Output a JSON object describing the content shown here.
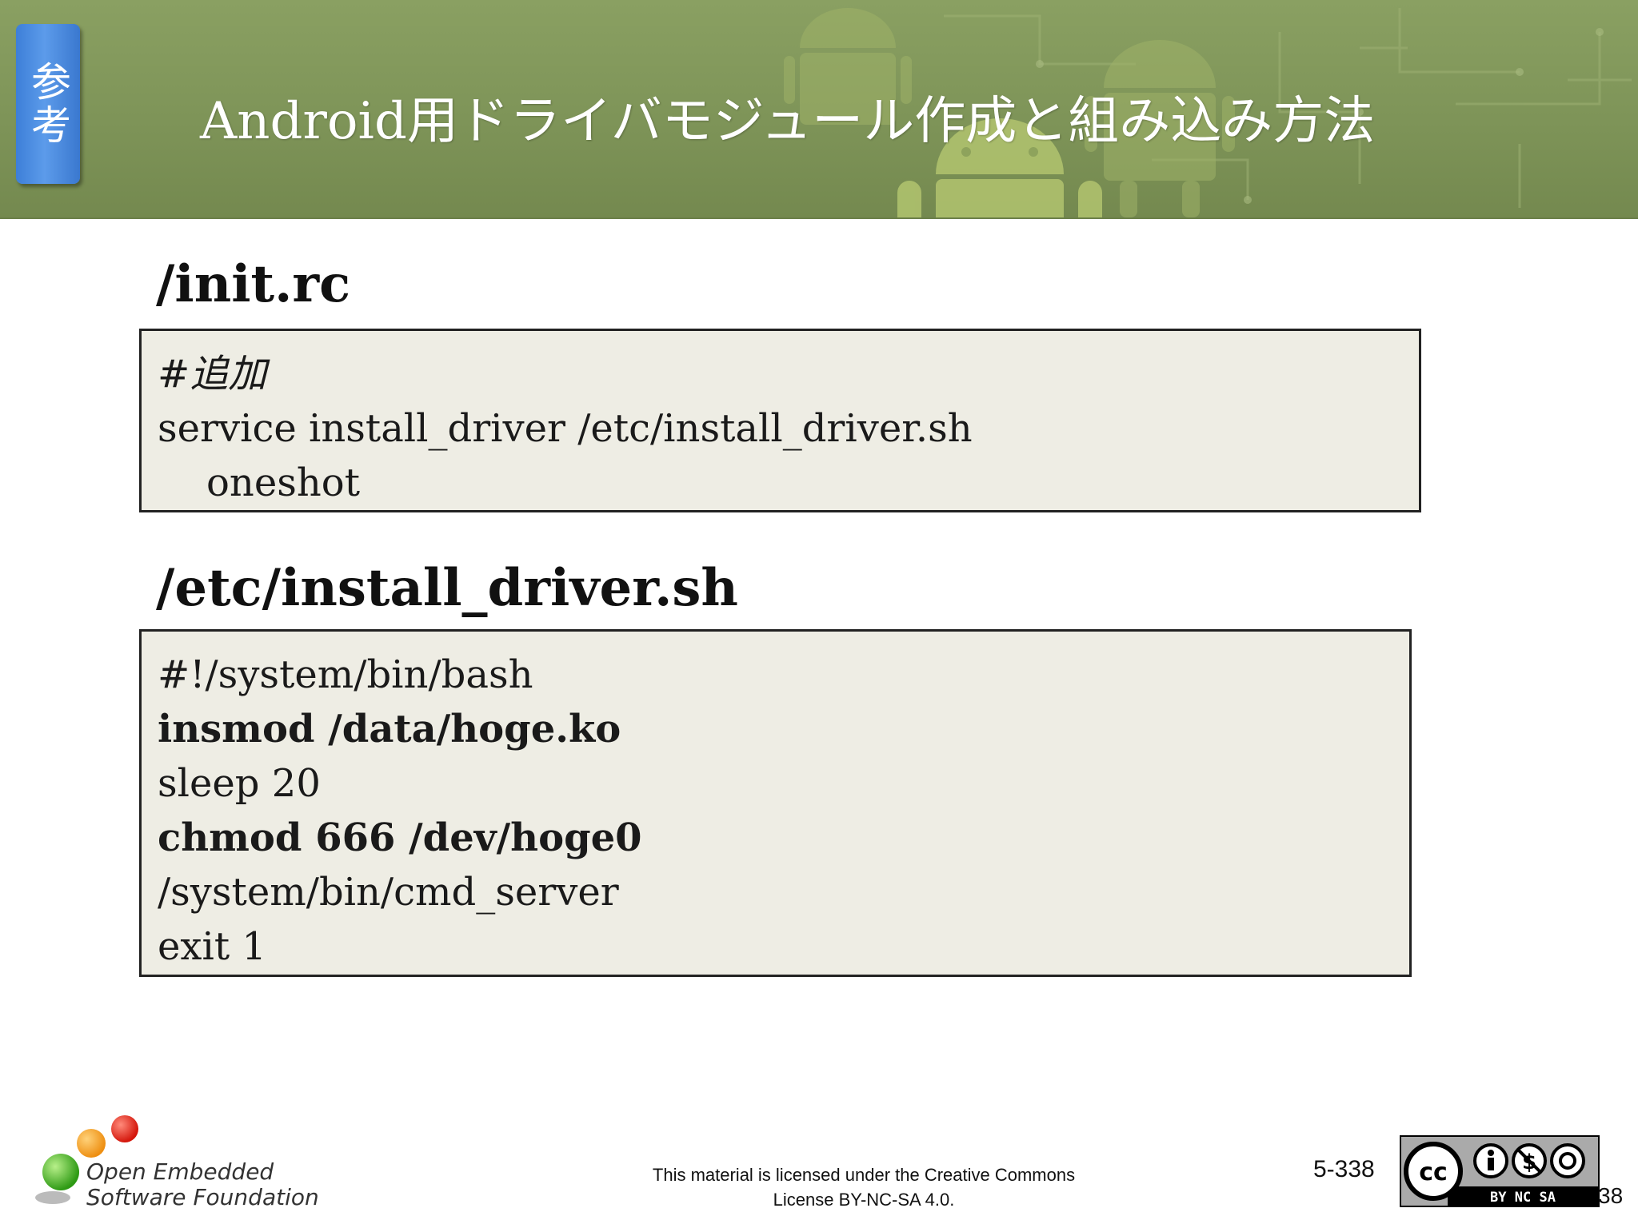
{
  "header": {
    "badge_label": "参考",
    "title": "Android用ドライバモジュール作成と組み込み方法",
    "accent_color": "#7e9458",
    "badge_color": "#4a8ae0"
  },
  "sections": [
    {
      "heading": "/init.rc",
      "lines": [
        "#追加",
        "service install_driver /etc/install_driver.sh",
        "    oneshot"
      ]
    },
    {
      "heading": "/etc/install_driver.sh",
      "lines": [
        "#!/system/bin/bash",
        "insmod /data/hoge.ko",
        "sleep 20",
        "chmod 666 /dev/hoge0",
        "/system/bin/cmd_server",
        "exit 1"
      ]
    }
  ],
  "footer": {
    "logo_text_line1": "Open Embedded",
    "logo_text_line2": "Software Foundation",
    "license_line1": "This material is licensed under the Creative Commons",
    "license_line2": "License BY-NC-SA 4.0.",
    "page_number": "5-338",
    "page_number_short": "38",
    "cc_badge_icon": "cc-by-nc-sa-icon",
    "cc_terms": "BY  NC  SA"
  }
}
